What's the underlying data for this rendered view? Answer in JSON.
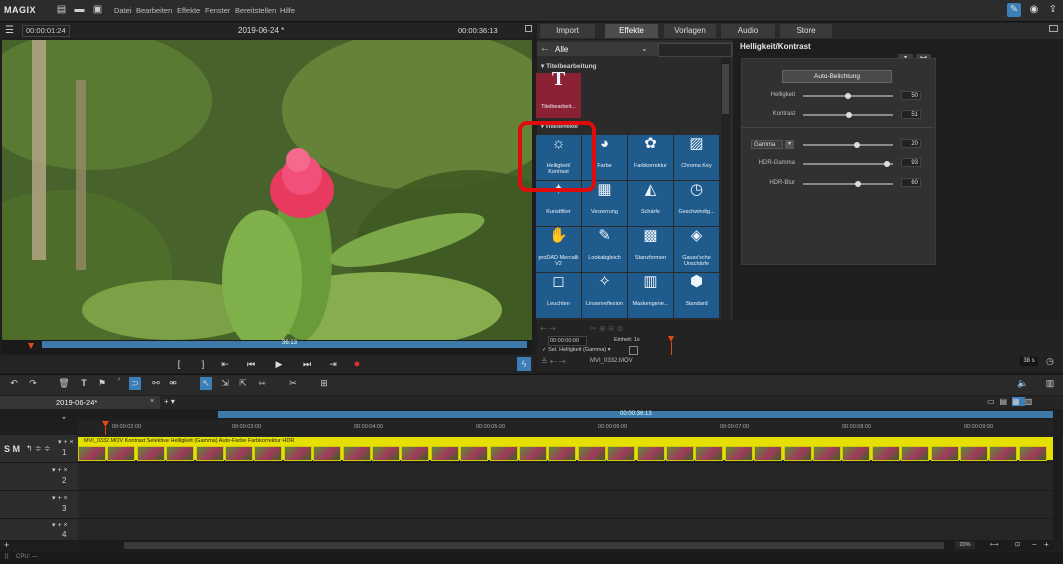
{
  "menubar": {
    "logo": "MAGIX",
    "items": [
      "Datei",
      "Bearbeiten",
      "Effekte",
      "Fenster",
      "Bereitstellen",
      "Hilfe"
    ]
  },
  "preview": {
    "timecode_left": "00:00:01:24",
    "title": "2019-06-24 *",
    "timecode_right": "00:00:36:13",
    "scrub_label": "36:13"
  },
  "transport": {
    "in_mark": "[",
    "out_mark": "]"
  },
  "right_tabs": [
    "Import",
    "Effekte",
    "Vorlagen",
    "Audio",
    "Store"
  ],
  "effects": {
    "filter_value": "Alle",
    "section_title": "Titelbearbeitung",
    "section_video": "Videoeffekte",
    "title_tile": "Titelbearbeit...",
    "tiles": [
      [
        "Helligkeit/ Kontrast",
        "Farbe",
        "Farbkorrektur",
        "Chroma Key"
      ],
      [
        "Kunstfilter",
        "Verzerrung",
        "Schärfe",
        "Geschwindig..."
      ],
      [
        "proDAD Mercalli V2",
        "Lookabgleich",
        "Stanzformen",
        "Gauss'sche Unschärfe"
      ],
      [
        "Leuchten",
        "Linsenreflexion",
        "Maskengene...",
        "Standard"
      ]
    ]
  },
  "params": {
    "title": "Helligkeit/Kontrast",
    "auto_button": "Auto-Belichtung",
    "rows": [
      {
        "label": "Helligkeit",
        "value": "50",
        "pos": 0.5
      },
      {
        "label": "Kontrast",
        "value": "51",
        "pos": 0.51
      },
      {
        "label": "Gamma",
        "value": "20",
        "pos": 0.4
      },
      {
        "label": "HDR-Gamma",
        "value": "93",
        "pos": 0.93
      },
      {
        "label": "HDR-Blur",
        "value": "60",
        "pos": 0.6
      }
    ]
  },
  "keyframes": {
    "timecode": "00:00:00:00",
    "unit_label": "Einheit: 1s",
    "track_label": "Sel. Helligkeit (Gamma)",
    "clip_name": "MVI_0332.MOV",
    "duration": "38 s"
  },
  "timeline": {
    "project_tab": "2019-06-24*",
    "timecode": "00:00:36:13",
    "ruler": [
      "00:00:02:00",
      "00:00:03:00",
      "00:00:04:00",
      "00:00:05:00",
      "00:00:06:00",
      "00:00:07:00",
      "00:00:08:00",
      "00:00:09:00"
    ],
    "clip_label": "MVI_0332.MOV  Kontrast  Selektive Helligkeit (Gamma)  Auto-Farbe  Farbkorrektur  HDR",
    "track_numbers": [
      "1",
      "2",
      "3",
      "4"
    ],
    "zoom": "20%",
    "track_head_label": "S M"
  },
  "statusbar": {
    "cpu": "CPU: —"
  },
  "colors": {
    "tile_blue": "#1f5b8c",
    "clip_yellow": "#e6e000",
    "highlight_red": "#e00b0b",
    "title_tile": "#8b2233"
  }
}
